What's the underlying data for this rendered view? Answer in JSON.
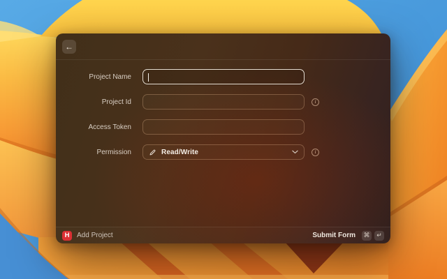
{
  "icons": {
    "back": "←",
    "pencil": "pencil-icon",
    "chevron_down": "chevron-down-icon",
    "info": "i",
    "command": "⌘",
    "return": "↵"
  },
  "window": {
    "form": {
      "fields": [
        {
          "label": "Project Name",
          "value": "",
          "placeholder": "",
          "focused": true
        },
        {
          "label": "Project Id",
          "value": "",
          "placeholder": "",
          "has_info": true
        },
        {
          "label": "Access Token",
          "value": "",
          "placeholder": ""
        },
        {
          "label": "Permission",
          "value": "Read/Write",
          "type": "dropdown",
          "has_info": true
        }
      ]
    },
    "footer": {
      "app_icon_letter": "H",
      "title": "Add Project",
      "action_label": "Submit Form",
      "shortcut_keys": [
        "⌘",
        "↵"
      ]
    }
  },
  "colors": {
    "app_icon_red": "#dc3034",
    "focus_ring": "#f5eee2",
    "wallpaper_blue": "#4596d9",
    "wallpaper_orange": "#f2922f",
    "wallpaper_yellow": "#fcc948"
  }
}
